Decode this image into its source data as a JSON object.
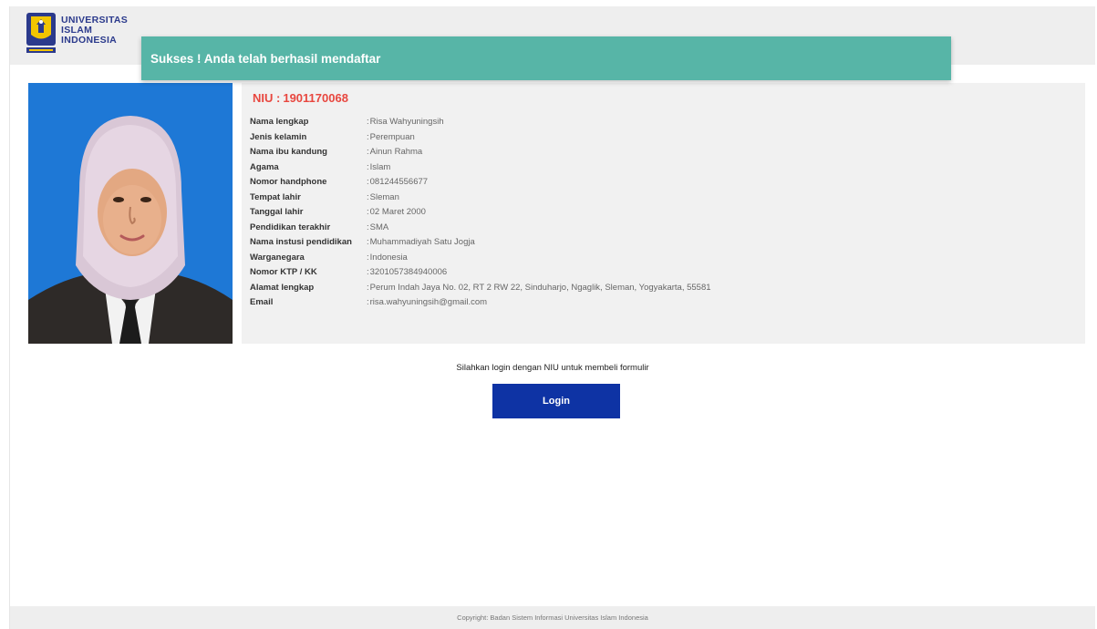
{
  "header": {
    "logo_lines": [
      "UNIVERSITAS",
      "ISLAM",
      "INDONESIA"
    ]
  },
  "toast": {
    "message": "Sukses ! Anda telah berhasil mendaftar"
  },
  "profile": {
    "niu_label": "NIU :",
    "niu_value": "1901170068",
    "fields": [
      {
        "label": "Nama lengkap",
        "value": "Risa Wahyuningsih"
      },
      {
        "label": "Jenis kelamin",
        "value": "Perempuan"
      },
      {
        "label": "Nama ibu kandung",
        "value": "Ainun Rahma"
      },
      {
        "label": "Agama",
        "value": "Islam"
      },
      {
        "label": "Nomor handphone",
        "value": "081244556677"
      },
      {
        "label": "Tempat lahir",
        "value": "Sleman"
      },
      {
        "label": "Tanggal lahir",
        "value": "02 Maret 2000"
      },
      {
        "label": "Pendidikan terakhir",
        "value": "SMA"
      },
      {
        "label": "Nama instusi pendidikan",
        "value": "Muhammadiyah Satu Jogja"
      },
      {
        "label": "Warganegara",
        "value": "Indonesia"
      },
      {
        "label": "Nomor KTP / KK",
        "value": "3201057384940006"
      },
      {
        "label": "Alamat lengkap",
        "value": "Perum Indah Jaya No. 02, RT 2 RW 22, Sinduharjo, Ngaglik, Sleman, Yogyakarta, 55581"
      },
      {
        "label": "Email",
        "value": "risa.wahyuningsih@gmail.com"
      }
    ]
  },
  "cta": {
    "text": "Silahkan login dengan NIU untuk membeli formulir",
    "login_label": "Login"
  },
  "footer": {
    "copyright": "Copyright: Badan Sistem Informasi Universitas Islam Indonesia"
  },
  "colors": {
    "toast": "#57b5a7",
    "niu": "#e8473f",
    "login_button": "#0e33a4",
    "photo_background": "#1e78d6"
  }
}
